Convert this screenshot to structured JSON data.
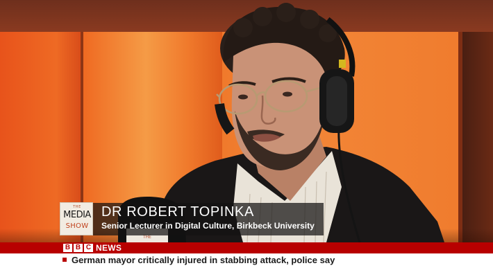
{
  "broadcast": {
    "channel_logo_letters": [
      "B",
      "B",
      "C"
    ],
    "channel_word": "NEWS",
    "accent_color": "#b80000"
  },
  "show_logo": {
    "line_the": "THE",
    "line_media": "MEDIA",
    "line_show": "SHOW",
    "mic_flag_text": "THE"
  },
  "lower_third": {
    "name": "DR ROBERT TOPINKA",
    "title": "Senior Lecturer in Digital Culture, Birkbeck University"
  },
  "ticker": {
    "headline": "German mayor critically injured in stabbing attack, police say"
  }
}
